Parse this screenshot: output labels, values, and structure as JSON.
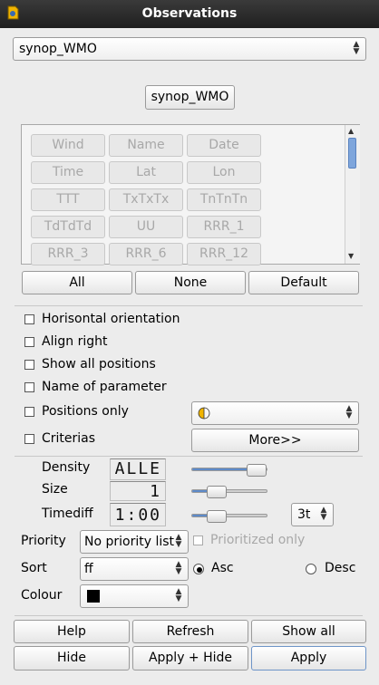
{
  "window": {
    "title": "Observations"
  },
  "top_combo": {
    "value": "synop_WMO"
  },
  "type_button": {
    "label": "synop_WMO"
  },
  "parameters": [
    "Wind",
    "Name",
    "Date",
    "Time",
    "Lat",
    "Lon",
    "TTT",
    "TxTxTx",
    "TnTnTn",
    "TdTdTd",
    "UU",
    "RRR_1",
    "RRR_3",
    "RRR_6",
    "RRR_12"
  ],
  "select_buttons": {
    "all": "All",
    "none": "None",
    "default": "Default"
  },
  "options": {
    "horizontal": "Horisontal orientation",
    "align_right": "Align right",
    "show_all_positions": "Show all positions",
    "name_of_parameter": "Name of parameter",
    "positions_only": "Positions only",
    "criterias": "Criterias"
  },
  "more_button": "More>>",
  "density": {
    "label": "Density",
    "value": "ALLE",
    "level": 0.85
  },
  "size": {
    "label": "Size",
    "value": "1",
    "level": 0.32
  },
  "timediff": {
    "label": "Timediff",
    "value": "1:00",
    "level": 0.32,
    "combo": "3t"
  },
  "priority": {
    "label": "Priority",
    "value": "No priority list",
    "checkbox": "Prioritized only"
  },
  "sort": {
    "label": "Sort",
    "value": "ff",
    "asc": "Asc",
    "desc": "Desc"
  },
  "colour": {
    "label": "Colour",
    "value": "#000000"
  },
  "buttons": {
    "help": "Help",
    "refresh": "Refresh",
    "show_all": "Show all",
    "hide": "Hide",
    "apply_hide": "Apply + Hide",
    "apply": "Apply"
  },
  "colors": {
    "slider_fill": "#5d8ac9",
    "marker": "#f0b400"
  }
}
